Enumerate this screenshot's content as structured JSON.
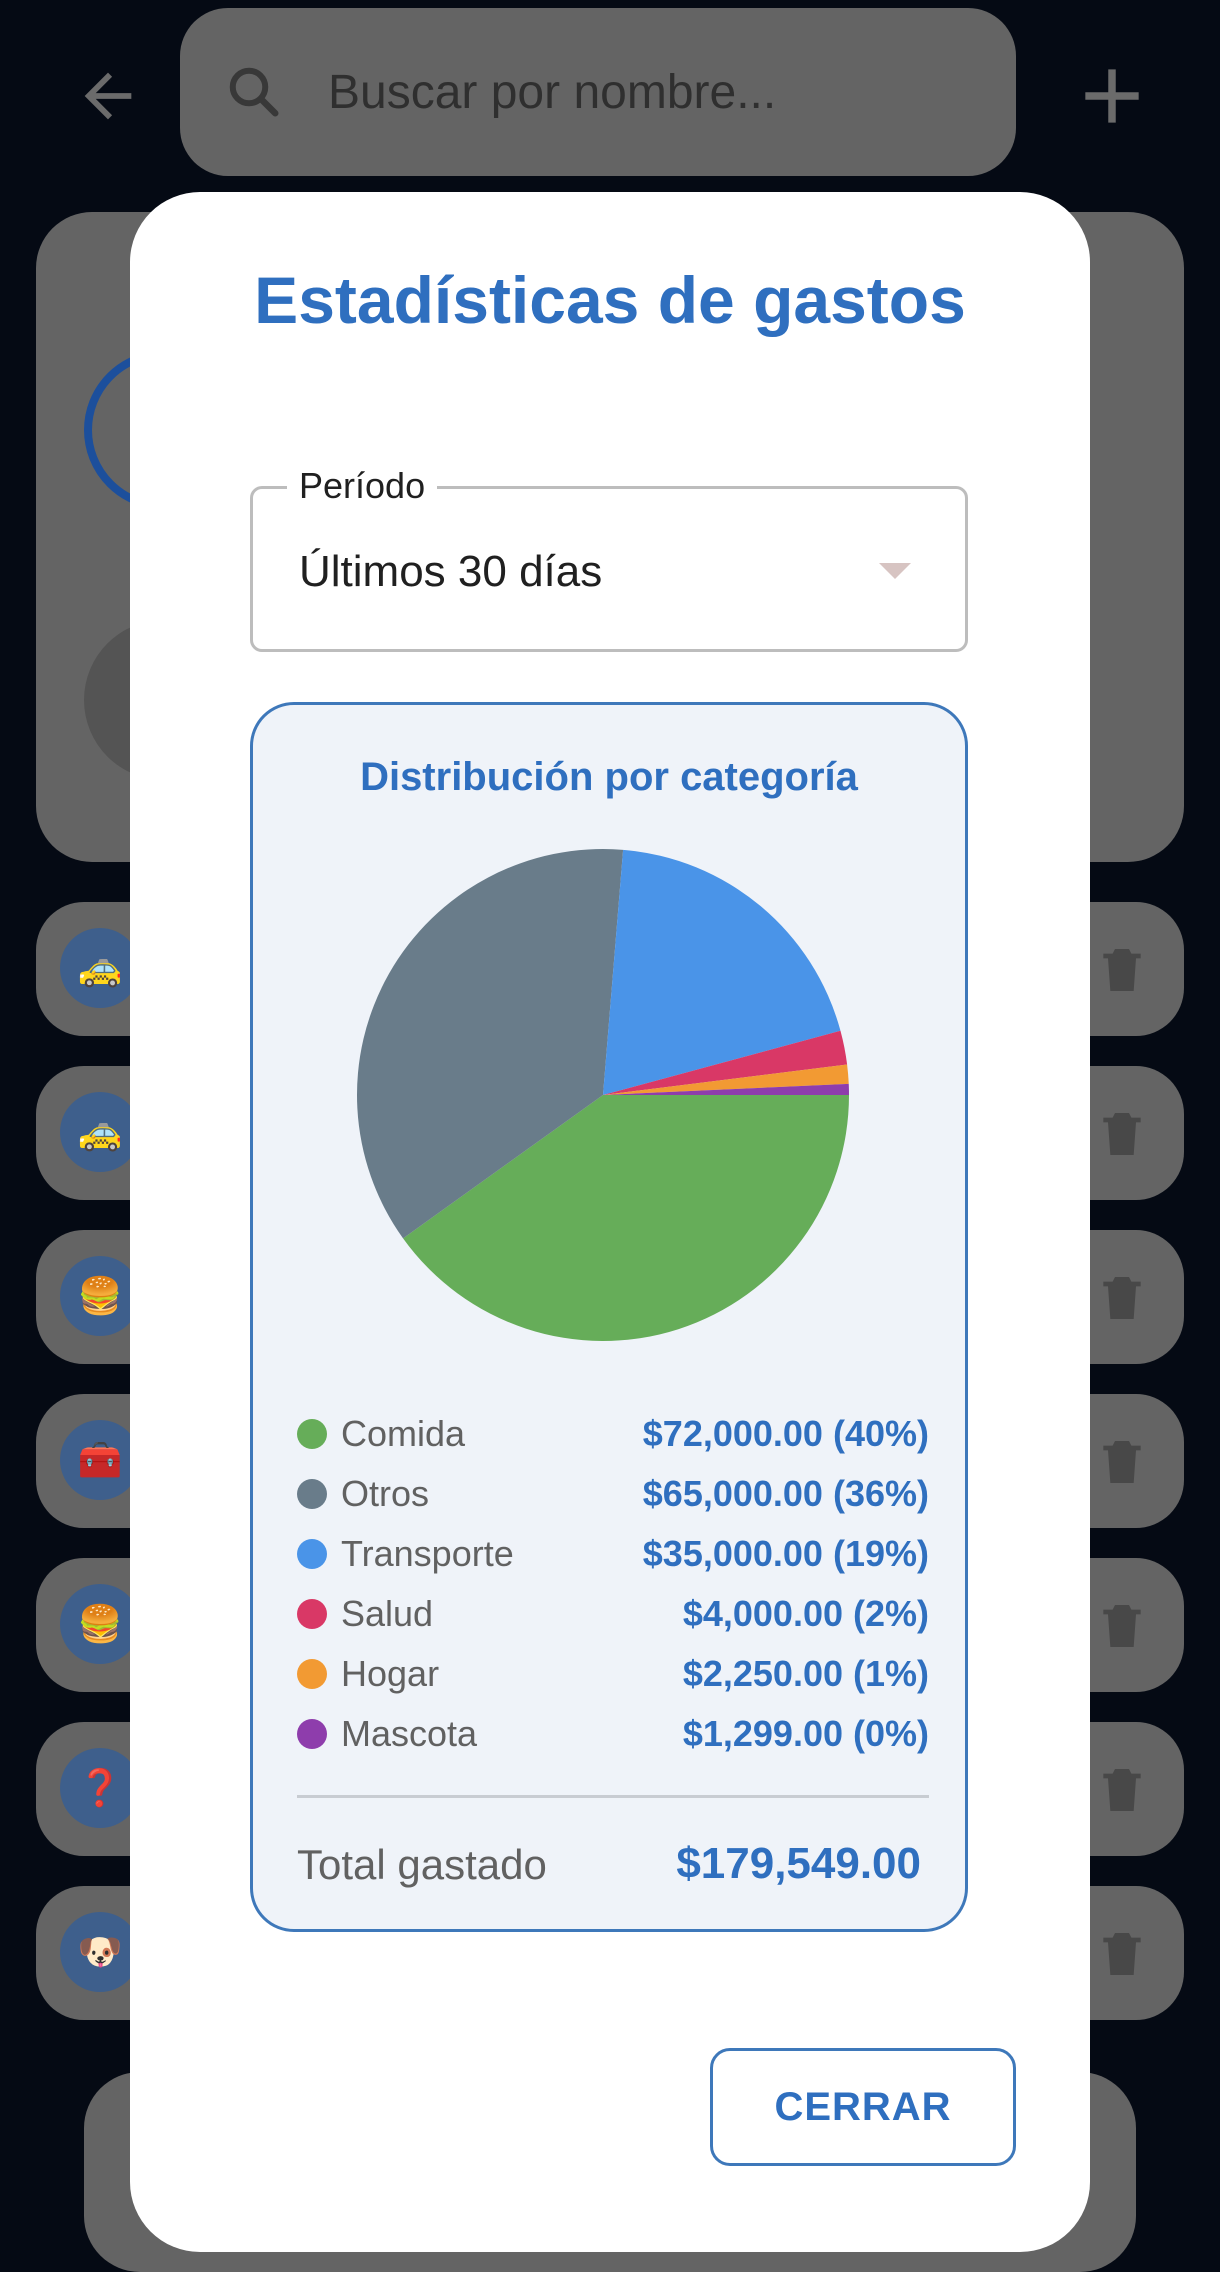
{
  "search": {
    "placeholder": "Buscar por nombre..."
  },
  "rows": [
    {
      "icon": "🚕"
    },
    {
      "icon": "🚕"
    },
    {
      "icon": "🍔"
    },
    {
      "icon": "🧰"
    },
    {
      "icon": "🍔"
    },
    {
      "icon": "❓"
    },
    {
      "icon": "🐶"
    }
  ],
  "dialog": {
    "title": "Estadísticas de gastos",
    "period": {
      "label": "Período",
      "value": "Últimos 30 días"
    },
    "chart": {
      "title": "Distribución por categoría",
      "legend": [
        {
          "label": "Comida",
          "value": "$72,000.00 (40%)"
        },
        {
          "label": "Otros",
          "value": "$65,000.00 (36%)"
        },
        {
          "label": "Transporte",
          "value": "$35,000.00 (19%)"
        },
        {
          "label": "Salud",
          "value": "$4,000.00 (2%)"
        },
        {
          "label": "Hogar",
          "value": "$2,250.00 (1%)"
        },
        {
          "label": "Mascota",
          "value": "$1,299.00 (0%)"
        }
      ],
      "total_label": "Total gastado",
      "total_value": "$179,549.00"
    },
    "close_label": "CERRAR"
  },
  "chart_data": {
    "type": "pie",
    "title": "Distribución por categoría",
    "categories": [
      "Comida",
      "Otros",
      "Transporte",
      "Salud",
      "Hogar",
      "Mascota"
    ],
    "values": [
      72000,
      65000,
      35000,
      4000,
      2250,
      1299
    ],
    "colors": [
      "#66ad59",
      "#697c8a",
      "#4a94e8",
      "#d93866",
      "#f29a33",
      "#8e3dac"
    ],
    "total": 179549
  }
}
